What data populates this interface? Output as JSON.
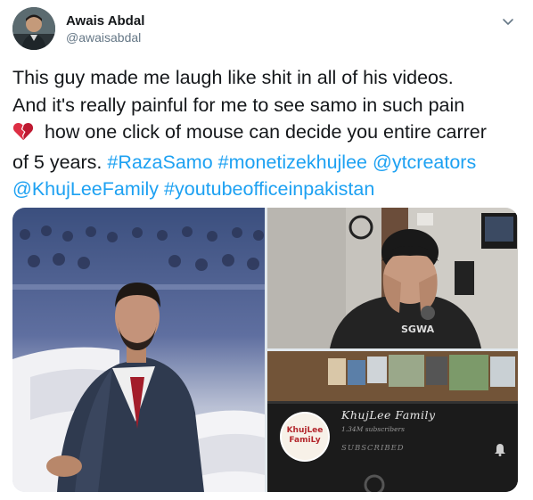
{
  "user": {
    "display_name": "Awais Abdal",
    "handle": "@awaisabdal"
  },
  "tweet": {
    "line1": "This guy made me laugh like shit in all of his videos.",
    "line2": "And it's really painful for me to see samo in such pain",
    "line3": " how one click of mouse can decide you entire carrer",
    "line4_prefix": "of 5 years. ",
    "hashtag_razasamo": "#RazaSamo",
    "hashtag_monetize": "#monetizekhujlee",
    "mention_ytcreators": "@ytcreators",
    "mention_khujleefamily": "@KhujLeeFamily",
    "hashtag_youtubeoffice": "#youtubeofficeinpakistan"
  },
  "media": {
    "channel": {
      "logo_text_line1": "KhujLee",
      "logo_text_line2": "FamiLy",
      "name": "KhujLee Family",
      "subscribers": "1.34M subscribers",
      "subscribe_label": "SUBSCRIBED"
    },
    "shirt_text": "SGWA"
  },
  "icons": {
    "caret": "chevron-down-icon",
    "heart": "broken-heart-emoji",
    "bell": "bell-icon"
  },
  "colors": {
    "link": "#1da1f2",
    "text": "#14171a",
    "secondary": "#657786"
  }
}
